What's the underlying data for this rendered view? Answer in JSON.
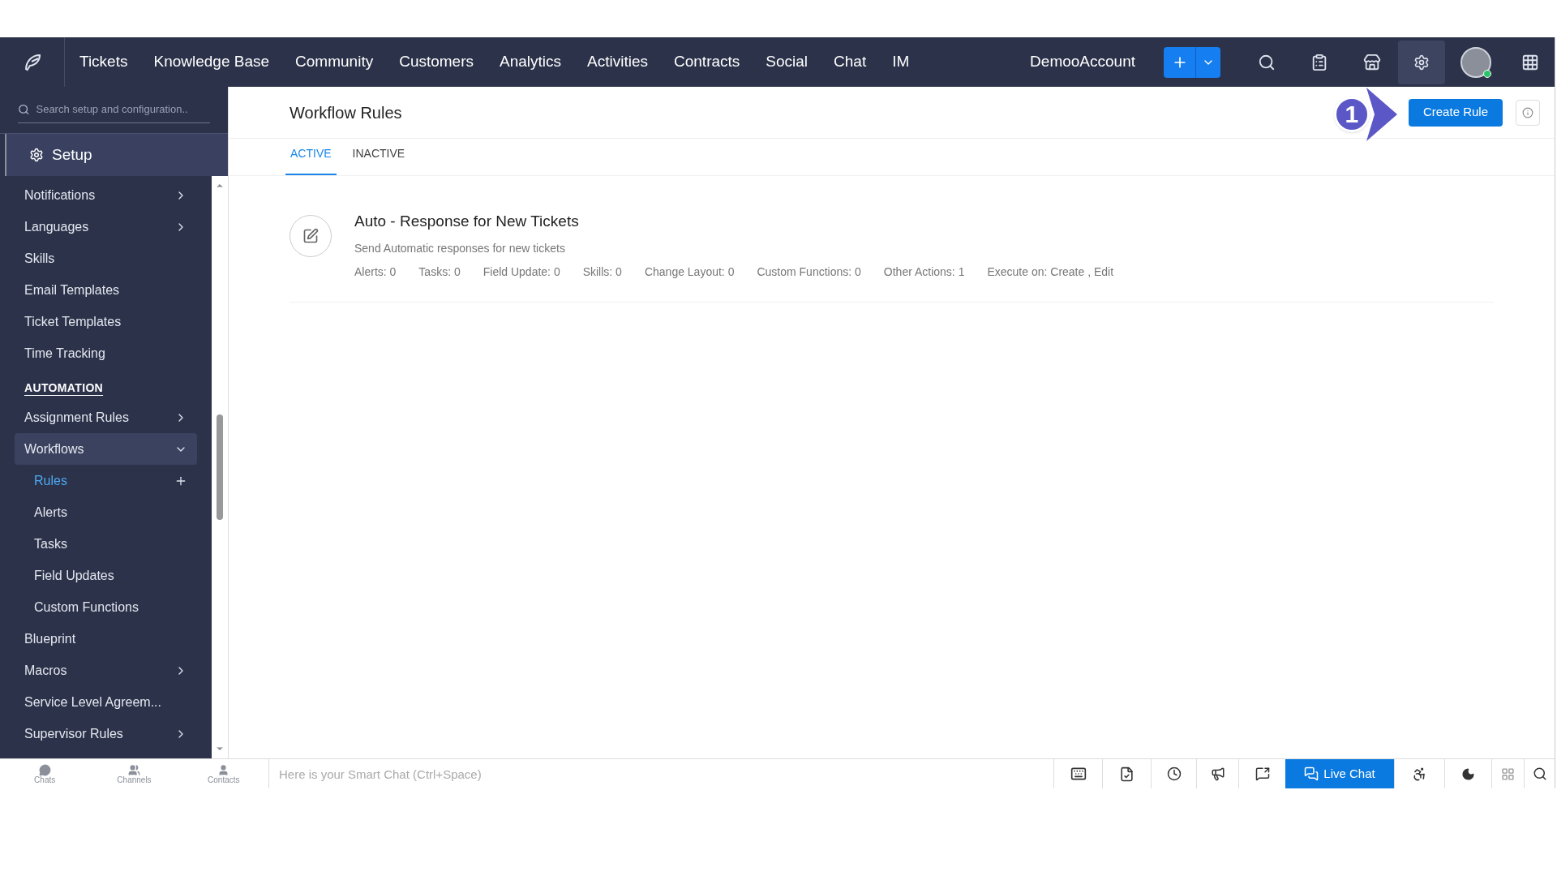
{
  "topbar": {
    "menu": [
      {
        "label": "Tickets"
      },
      {
        "label": "Knowledge Base"
      },
      {
        "label": "Community"
      },
      {
        "label": "Customers"
      },
      {
        "label": "Analytics"
      },
      {
        "label": "Activities"
      },
      {
        "label": "Contracts"
      },
      {
        "label": "Social"
      },
      {
        "label": "Chat"
      },
      {
        "label": "IM"
      }
    ],
    "account": "DemooAccount",
    "settings_selected": true
  },
  "sidebar": {
    "search": {
      "placeholder": "Search setup and configuration.."
    },
    "title": "Setup",
    "items": [
      {
        "kind": "item",
        "label": "Notifications",
        "expanded": false
      },
      {
        "kind": "item",
        "label": "Languages",
        "expanded": false
      },
      {
        "kind": "item",
        "label": "Skills"
      },
      {
        "kind": "item",
        "label": "Email Templates"
      },
      {
        "kind": "item",
        "label": "Ticket Templates"
      },
      {
        "kind": "item",
        "label": "Time Tracking"
      },
      {
        "kind": "heading",
        "label": "AUTOMATION"
      },
      {
        "kind": "item",
        "label": "Assignment Rules",
        "expanded": false
      },
      {
        "kind": "item",
        "label": "Workflows",
        "expanded": true,
        "children": [
          {
            "label": "Rules",
            "selected": true,
            "add": true
          },
          {
            "label": "Alerts",
            "selected": false
          },
          {
            "label": "Tasks",
            "selected": false
          },
          {
            "label": "Field Updates",
            "selected": false
          },
          {
            "label": "Custom Functions",
            "selected": false
          }
        ]
      },
      {
        "kind": "item",
        "label": "Blueprint"
      },
      {
        "kind": "item",
        "label": "Macros",
        "expanded": false
      },
      {
        "kind": "item",
        "label": "Service Level Agreem..."
      },
      {
        "kind": "item",
        "label": "Supervisor Rules",
        "expanded": false
      }
    ]
  },
  "page": {
    "title": "Workflow Rules",
    "create_button": "Create Rule",
    "step_marker": "1",
    "tabs": [
      {
        "label": "ACTIVE",
        "selected": true
      },
      {
        "label": "INACTIVE",
        "selected": false
      }
    ],
    "rules": [
      {
        "name": "Auto - Response for New Tickets",
        "description": "Send Automatic responses for new tickets",
        "stats": [
          "Alerts: 0",
          "Tasks: 0",
          "Field Update: 0",
          "Skills: 0",
          "Change Layout: 0",
          "Custom Functions: 0",
          "Other Actions: 1",
          "Execute on: Create , Edit"
        ]
      }
    ]
  },
  "bottombar": {
    "tabs": [
      {
        "label": "Chats",
        "kind": "chat"
      },
      {
        "label": "Channels",
        "kind": "group"
      },
      {
        "label": "Contacts",
        "kind": "user"
      }
    ],
    "smart_chat": {
      "placeholder": "Here is your Smart Chat (Ctrl+Space)"
    },
    "live_chat": "Live Chat"
  }
}
